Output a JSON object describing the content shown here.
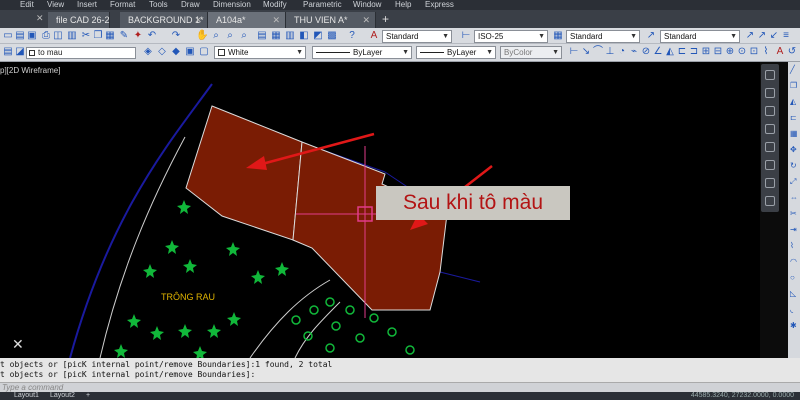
{
  "menu": [
    "Edit",
    "View",
    "Insert",
    "Format",
    "Tools",
    "Draw",
    "Dimension",
    "Modify",
    "Parametric",
    "Window",
    "Help",
    "Express"
  ],
  "tabs": [
    {
      "label": "file CAD 26-2*",
      "active": false
    },
    {
      "label": "BACKGROUND 1*",
      "active": false
    },
    {
      "label": "A104a*",
      "active": true
    },
    {
      "label": "THU VIEN A*",
      "active": false
    }
  ],
  "toolbar_styles": {
    "text_style": "Standard",
    "dim_style": "ISO-25",
    "table_style": "Standard",
    "multileader_style": "Standard"
  },
  "properties": {
    "layer": "to mau",
    "color": "White",
    "linetype": "ByLayer",
    "lineweight": "ByLayer",
    "plotstyle": "ByColor"
  },
  "viewport_label": "p][2D Wireframe]",
  "drawing": {
    "callout_text": "Sau khi tô màu",
    "area_label": "TRÔNG RAU",
    "fill_color": "#7a1c04",
    "cursor_color": "#e23b8a",
    "arrow_color": "#e01818",
    "boundary_color": "#1a1a9e",
    "tree_color": "#11b83a"
  },
  "command_history": [
    "t objects or [picK internal point/remove Boundaries]:1 found, 2 total",
    "t objects or [picK internal point/remove Boundaries]:"
  ],
  "command_placeholder": "Type a command",
  "layout_tabs": [
    "Layout1",
    "Layout2",
    "+"
  ],
  "status_text": "44585.3240, 27232.0000, 0.0000"
}
